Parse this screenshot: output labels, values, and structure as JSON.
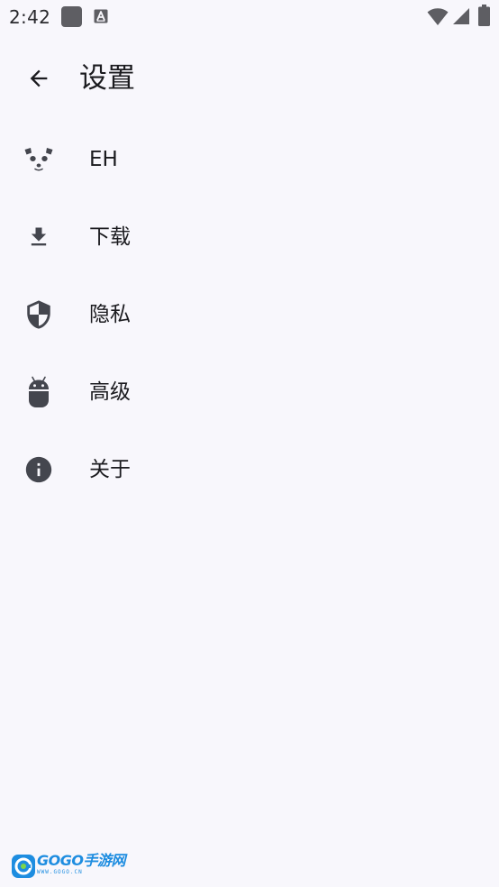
{
  "status_bar": {
    "time": "2:42",
    "icons": [
      "app-square-icon",
      "a-notification-icon",
      "wifi-icon",
      "signal-icon",
      "battery-icon"
    ]
  },
  "header": {
    "back_icon": "arrow-back-icon",
    "title": "设置"
  },
  "settings": {
    "items": [
      {
        "label": "EH",
        "icon": "panda-icon"
      },
      {
        "label": "下载",
        "icon": "download-icon"
      },
      {
        "label": "隐私",
        "icon": "shield-icon"
      },
      {
        "label": "高级",
        "icon": "android-icon"
      },
      {
        "label": "关于",
        "icon": "info-icon"
      }
    ]
  },
  "watermark": {
    "brand": "GOGO手游网",
    "url": "WWW.GOGO.CN"
  },
  "colors": {
    "background": "#F8F7FC",
    "icon": "#44464E",
    "text": "#1B1B1F",
    "watermark": "#1E8DE0"
  }
}
